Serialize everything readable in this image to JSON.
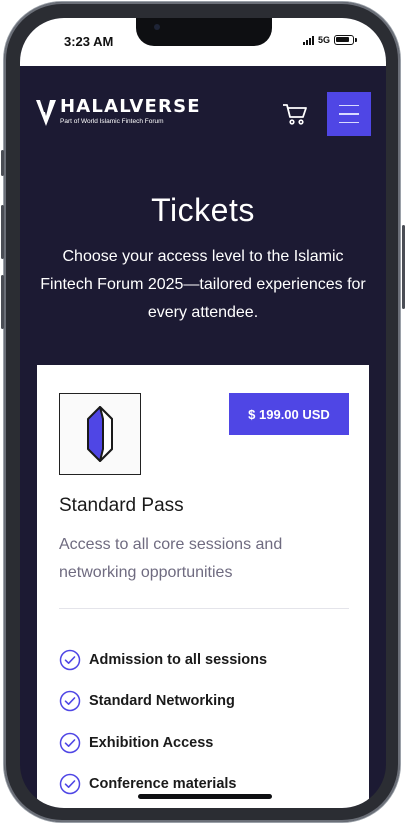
{
  "status_bar": {
    "time": "3:23 AM",
    "network": "5G"
  },
  "header": {
    "logo_word": "HALALVERSE",
    "logo_subtitle": "Part of World Islamic Fintech Forum",
    "icons": {
      "cart": "cart-icon",
      "menu": "hamburger-menu-icon"
    },
    "accent_color": "#4f46e5",
    "background_color": "#1c1a33"
  },
  "hero": {
    "title": "Tickets",
    "description": "Choose your access level to the Islamic Fintech Forum 2025—tailored experiences for every attendee."
  },
  "ticket": {
    "icon": "crystal-icon",
    "price": "$ 199.00 USD",
    "name": "Standard Pass",
    "description": "Access to all core sessions and networking opportunities",
    "features": [
      {
        "label": "Admission to all sessions"
      },
      {
        "label": "Standard Networking"
      },
      {
        "label": "Exhibition Access"
      },
      {
        "label": "Conference materials"
      }
    ]
  }
}
